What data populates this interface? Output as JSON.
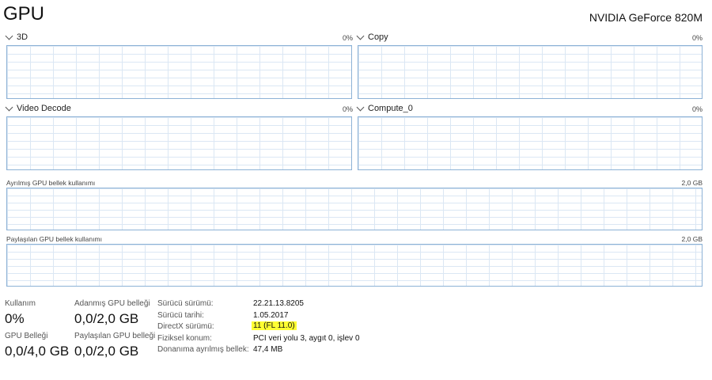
{
  "header": {
    "title": "GPU",
    "gpu_name": "NVIDIA GeForce 820M"
  },
  "engines": [
    {
      "name": "3D",
      "value": "0%"
    },
    {
      "name": "Copy",
      "value": "0%"
    },
    {
      "name": "Video Decode",
      "value": "0%"
    },
    {
      "name": "Compute_0",
      "value": "0%"
    }
  ],
  "memory_graphs": {
    "dedicated": {
      "label": "Ayrılmış GPU bellek kullanımı",
      "max": "2,0 GB"
    },
    "shared": {
      "label": "Paylaşılan GPU bellek kullanımı",
      "max": "2,0 GB"
    }
  },
  "stats": {
    "utilization": {
      "label": "Kullanım",
      "value": "0%"
    },
    "dedicated_memory": {
      "label": "Adanmış GPU belleği",
      "value": "0,0/2,0 GB"
    },
    "gpu_memory": {
      "label": "GPU Belleği",
      "value": "0,0/4,0 GB"
    },
    "shared_memory": {
      "label": "Paylaşılan GPU belleği",
      "value": "0,0/2,0 GB"
    }
  },
  "info": [
    {
      "label": "Sürücü sürümü:",
      "value": "22.21.13.8205"
    },
    {
      "label": "Sürücü tarihi:",
      "value": "1.05.2017"
    },
    {
      "label": "DirectX sürümü:",
      "value": "11 (FL 11.0)"
    },
    {
      "label": "Fiziksel konum:",
      "value": "PCI veri yolu 3, aygıt 0, işlev 0"
    },
    {
      "label": "Donanıma ayrılmış bellek:",
      "value": "47,4 MB"
    }
  ],
  "colors": {
    "graph_border": "#8db2d6",
    "grid": "#dbe7f4",
    "highlight": "#ffff33"
  }
}
